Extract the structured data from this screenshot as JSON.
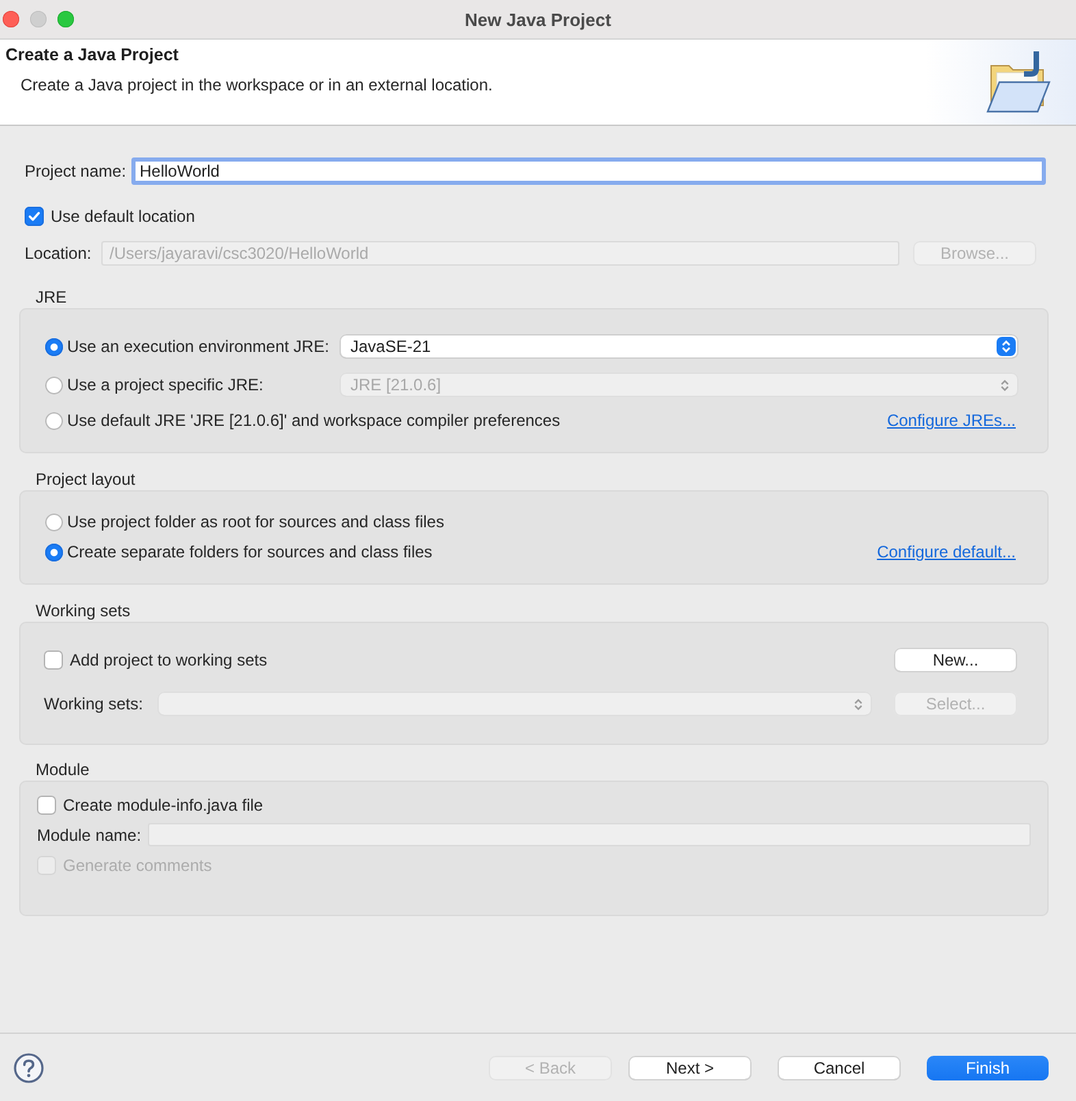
{
  "window": {
    "title": "New Java Project"
  },
  "header": {
    "title": "Create a Java Project",
    "description": "Create a Java project in the workspace or in an external location."
  },
  "project_name": {
    "label": "Project name:",
    "value": "HelloWorld",
    "focused": true
  },
  "default_location": {
    "label": "Use default location",
    "checked": true
  },
  "location": {
    "label": "Location:",
    "value": "/Users/jayaravi/csc3020/HelloWorld",
    "disabled": true,
    "button": {
      "label": "Browse...",
      "disabled": true
    }
  },
  "jre": {
    "title": "JRE",
    "options": [
      {
        "kind": "select",
        "label": "Use an execution environment JRE:",
        "selected": true,
        "value": "JavaSE-21",
        "disabled": false
      },
      {
        "kind": "select",
        "label": "Use a project specific JRE:",
        "selected": false,
        "value": "JRE [21.0.6]",
        "disabled": true
      },
      {
        "kind": "link",
        "label": "Use default JRE 'JRE [21.0.6]' and workspace compiler preferences",
        "selected": false,
        "link": "Configure JREs..."
      }
    ]
  },
  "project_layout": {
    "title": "Project layout",
    "options": [
      {
        "kind": "plain",
        "label": "Use project folder as root for sources and class files",
        "selected": false
      },
      {
        "kind": "link",
        "label": "Create separate folders for sources and class files",
        "selected": true,
        "link": "Configure default..."
      }
    ]
  },
  "working_sets": {
    "title": "Working sets",
    "checkbox": {
      "label": "Add project to working sets",
      "checked": false
    },
    "new_button": {
      "label": "New...",
      "disabled": false
    },
    "field": {
      "label": "Working sets:",
      "disabled": true
    },
    "select_button": {
      "label": "Select...",
      "disabled": true
    }
  },
  "module": {
    "title": "Module",
    "checkbox": {
      "label": "Create module-info.java file",
      "checked": false
    },
    "name_field": {
      "label": "Module name:",
      "disabled": true
    },
    "comments": {
      "label": "Generate comments",
      "checked": false,
      "disabled": true
    }
  },
  "buttons": [
    {
      "label": "< Back",
      "kind": "normal",
      "disabled": true
    },
    {
      "label": "Next >",
      "kind": "normal",
      "disabled": false
    },
    {
      "label": "Cancel",
      "kind": "normal",
      "disabled": false
    },
    {
      "label": "Finish",
      "kind": "primary",
      "disabled": false
    }
  ]
}
